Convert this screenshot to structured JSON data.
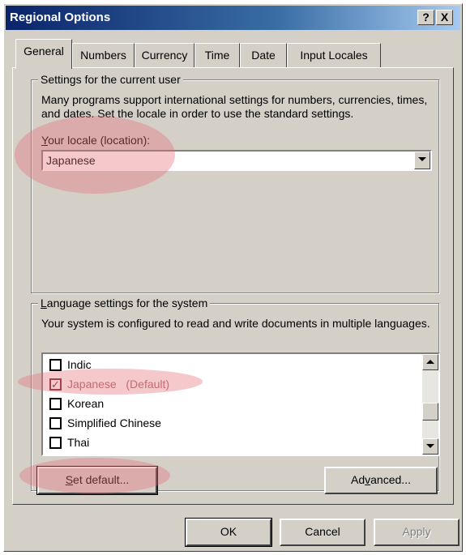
{
  "window": {
    "title": "Regional Options",
    "help_button": "?",
    "close_button": "X"
  },
  "tabs": [
    {
      "label": "General",
      "active": true
    },
    {
      "label": "Numbers",
      "active": false
    },
    {
      "label": "Currency",
      "active": false
    },
    {
      "label": "Time",
      "active": false
    },
    {
      "label": "Date",
      "active": false
    },
    {
      "label": "Input Locales",
      "active": false
    }
  ],
  "user_settings": {
    "group_label": "Settings for the current user",
    "description": "Many programs support international settings for numbers, currencies, times, and dates. Set the locale in order to use the standard settings.",
    "locale_label_prefix": "Y",
    "locale_label_rest": "our locale (location):",
    "locale_value": "Japanese"
  },
  "language_settings": {
    "group_label_prefix": "L",
    "group_label_rest": "anguage settings for the system",
    "description": "Your system is configured to read and write documents in multiple languages.",
    "languages": [
      {
        "name": "Indic",
        "checked": false,
        "default": false
      },
      {
        "name": "Japanese",
        "checked": true,
        "default": true,
        "suffix": "(Default)"
      },
      {
        "name": "Korean",
        "checked": false,
        "default": false
      },
      {
        "name": "Simplified Chinese",
        "checked": false,
        "default": false
      },
      {
        "name": "Thai",
        "checked": false,
        "default": false
      }
    ],
    "set_default_prefix": "S",
    "set_default_rest": "et default...",
    "advanced_prefix": "Ad",
    "advanced_u": "v",
    "advanced_rest": "anced..."
  },
  "footer": {
    "ok_label": "OK",
    "cancel_label": "Cancel",
    "apply_label": "Apply"
  },
  "colors": {
    "highlight": "#e66e78",
    "title_bar": "#0a246a",
    "face": "#d4d0c8"
  }
}
